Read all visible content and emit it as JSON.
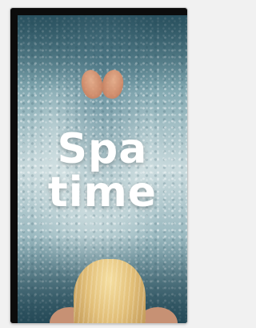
{
  "story": {
    "title_line1": "Spa",
    "title_line2": "time"
  }
}
